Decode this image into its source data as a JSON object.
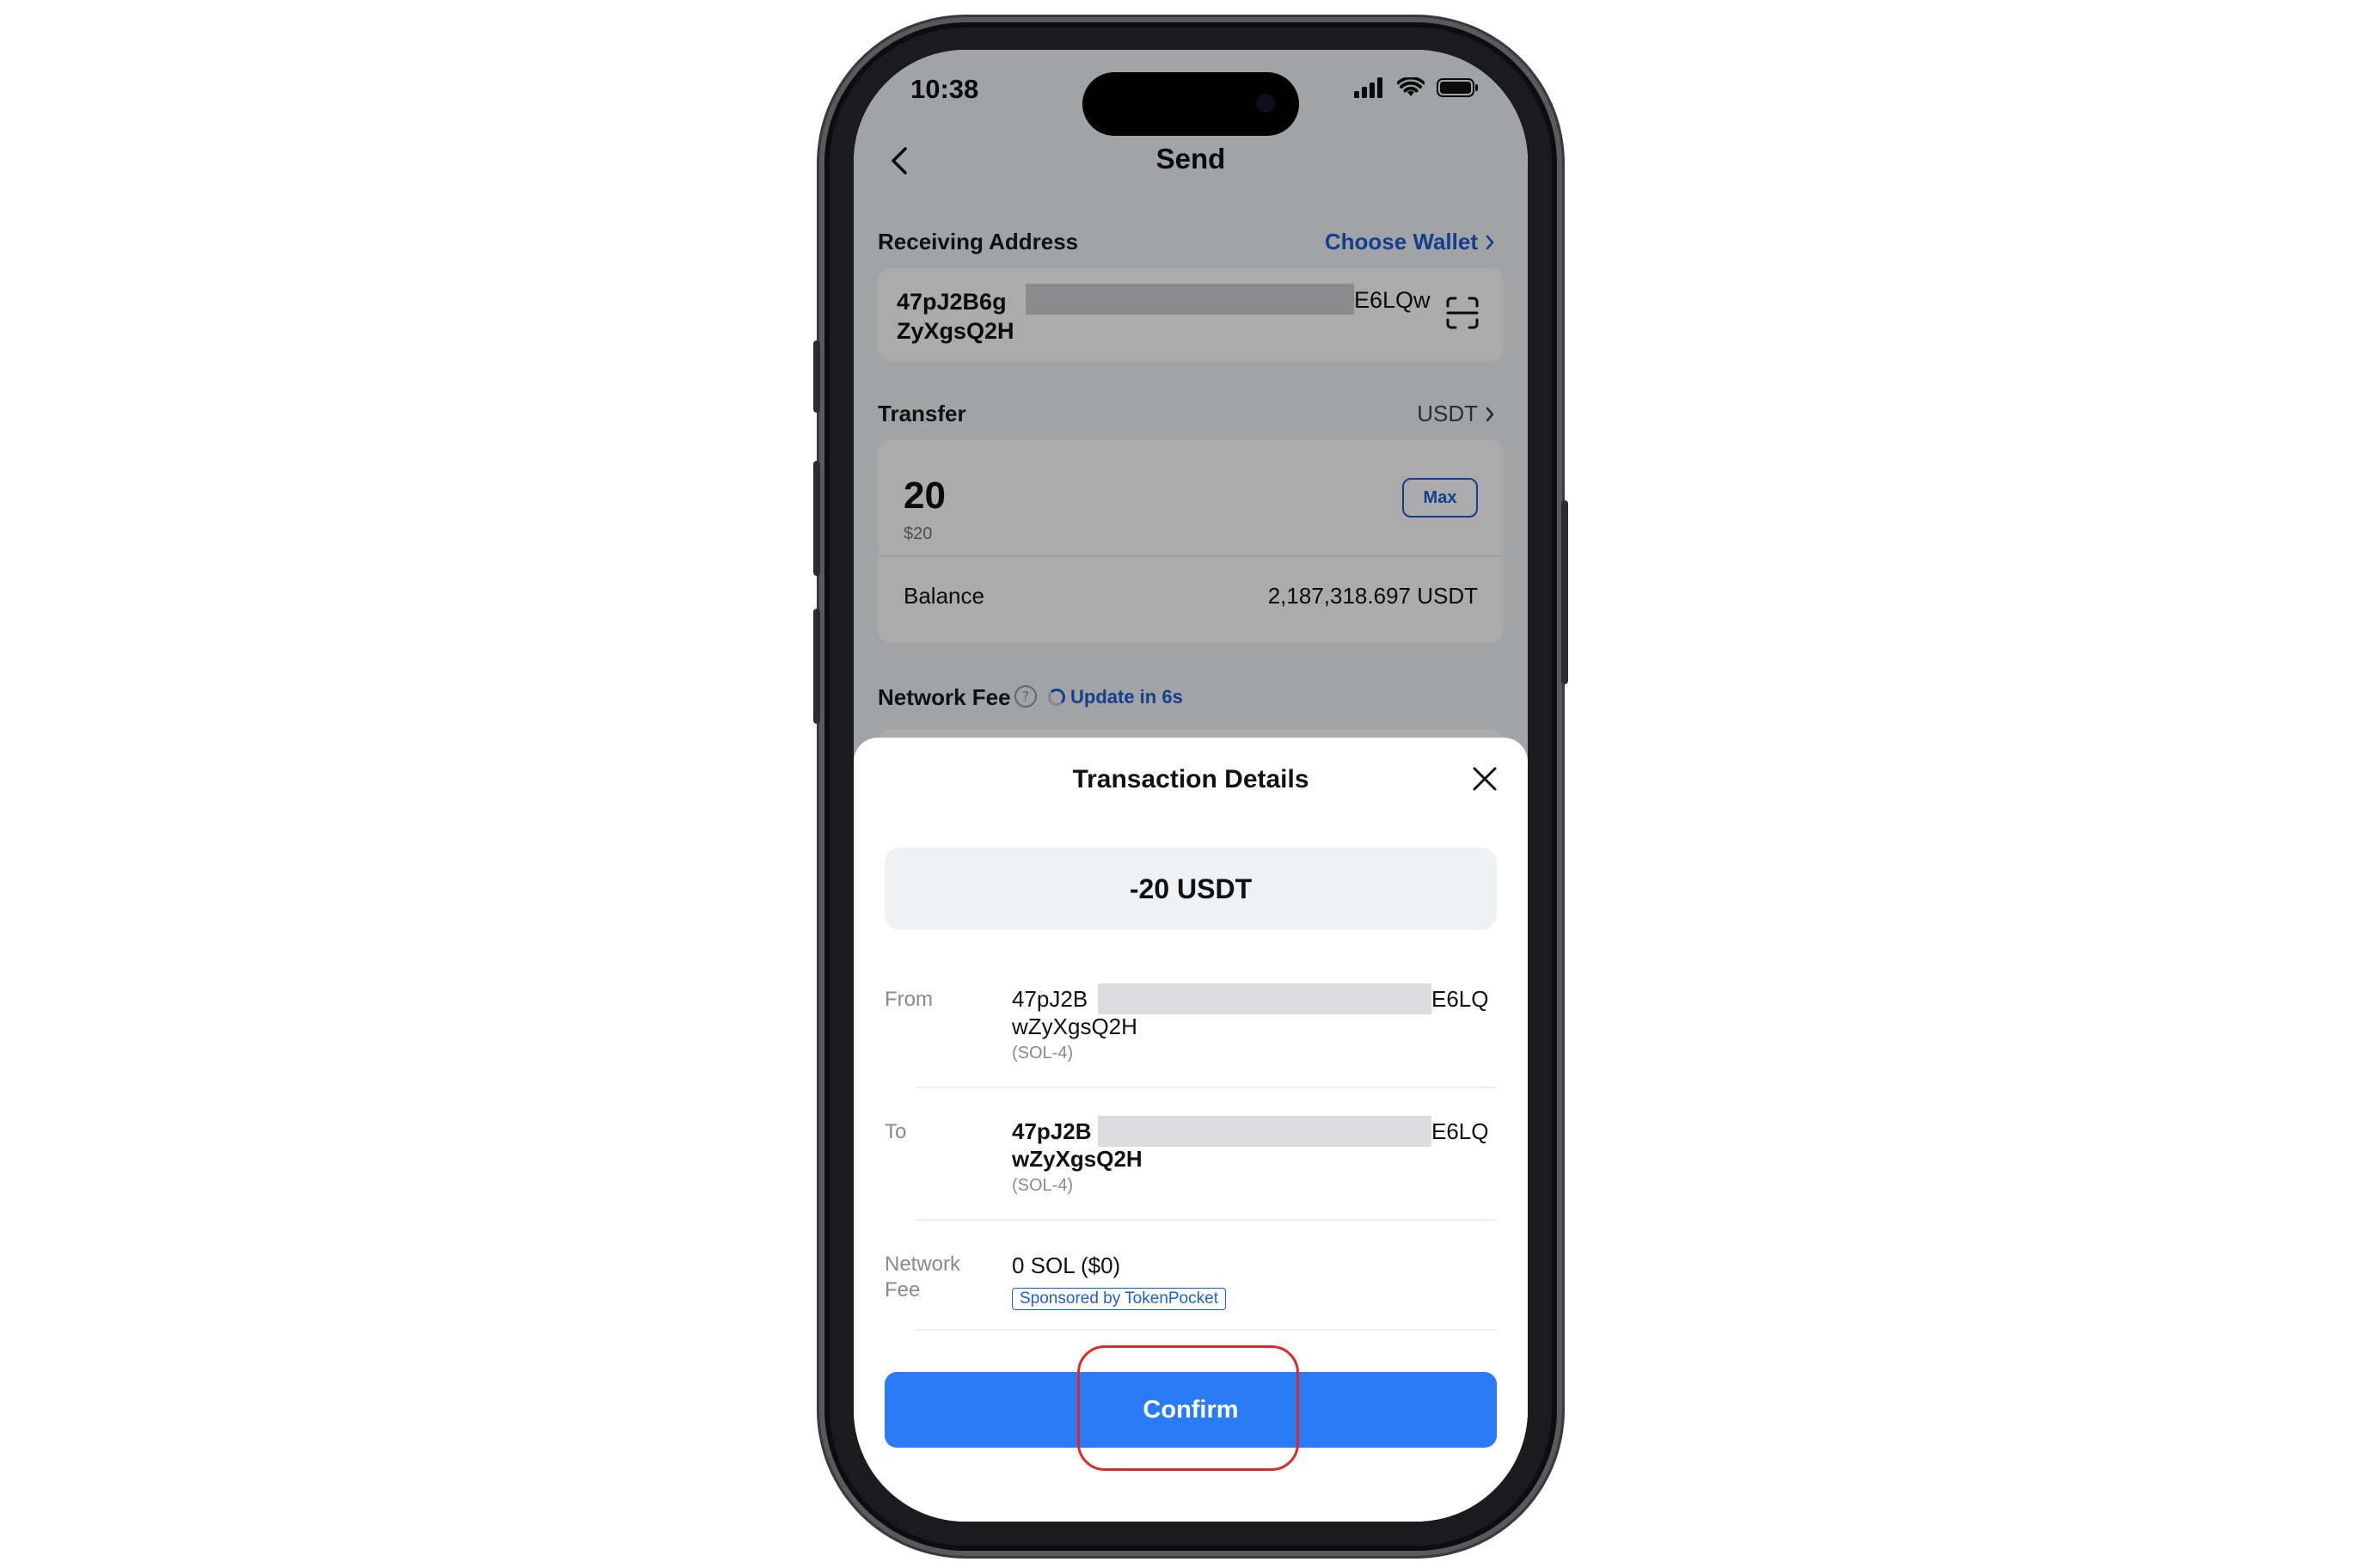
{
  "status_bar": {
    "time": "10:38"
  },
  "nav": {
    "title": "Send"
  },
  "receiving": {
    "label": "Receiving Address",
    "choose_wallet": "Choose Wallet",
    "address_line1": "47pJ2B6g",
    "address_line1_end": "E6LQw",
    "address_line2": "ZyXgsQ2H"
  },
  "transfer": {
    "label": "Transfer",
    "token": "USDT",
    "amount": "20",
    "amount_usd": "$20",
    "max_label": "Max",
    "balance_label": "Balance",
    "balance_value": "2,187,318.697 USDT"
  },
  "network_fee": {
    "label": "Network Fee",
    "update_text": "Update in 6s"
  },
  "sheet": {
    "title": "Transaction Details",
    "amount": "-20 USDT",
    "from_label": "From",
    "from_line1": "47pJ2B",
    "from_line1_end": "E6LQ",
    "from_line2": "wZyXgsQ2H",
    "from_chain": "(SOL-4)",
    "to_label": "To",
    "to_line1": "47pJ2B",
    "to_line1_end": "E6LQ",
    "to_line2": "wZyXgsQ2H",
    "to_chain": "(SOL-4)",
    "fee_label_1": "Network",
    "fee_label_2": "Fee",
    "fee_value": "0 SOL ($0)",
    "sponsor_badge": "Sponsored by TokenPocket",
    "confirm_label": "Confirm"
  },
  "colors": {
    "accent": "#2a7cf6",
    "link": "#1f5fd6",
    "highlight": "#e0282c"
  },
  "icons": [
    "back-chevron-icon",
    "chevron-right-icon",
    "scan-icon",
    "help-circle-icon",
    "spinner-icon",
    "close-icon",
    "signal-icon",
    "wifi-icon",
    "battery-icon"
  ]
}
